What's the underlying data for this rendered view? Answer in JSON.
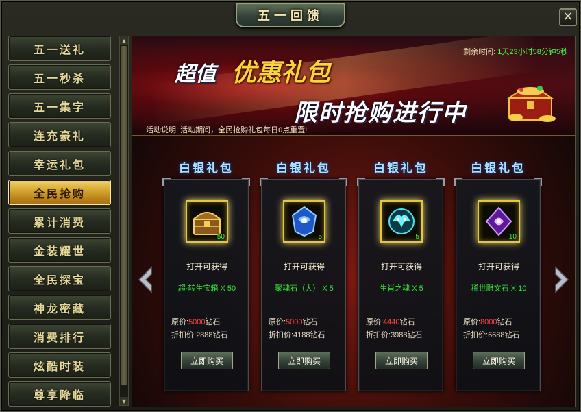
{
  "window": {
    "title": "五一回馈",
    "close_label": "✕"
  },
  "sidebar": {
    "items": [
      {
        "label": "五一送礼",
        "active": false
      },
      {
        "label": "五一秒杀",
        "active": false
      },
      {
        "label": "五一集字",
        "active": false
      },
      {
        "label": "连充豪礼",
        "active": false
      },
      {
        "label": "幸运礼包",
        "active": false
      },
      {
        "label": "全民抢购",
        "active": true
      },
      {
        "label": "累计消费",
        "active": false
      },
      {
        "label": "金装耀世",
        "active": false
      },
      {
        "label": "全民探宝",
        "active": false
      },
      {
        "label": "神龙密藏",
        "active": false
      },
      {
        "label": "消费排行",
        "active": false
      },
      {
        "label": "炫酷时装",
        "active": false
      },
      {
        "label": "尊享降临",
        "active": false
      }
    ]
  },
  "banner": {
    "line1_a": "超值",
    "line1_b": "优惠礼包",
    "line2": "限时抢购进行中",
    "timer_label": "剩余时间:",
    "timer_value": "1天23小时58分钟5秒",
    "desc": "活动说明: 活动期间，全民抢购礼包每日0点重置!"
  },
  "cards": [
    {
      "title": "白银礼包",
      "icon": "treasure-chest-icon",
      "count": "50",
      "open_label": "打开可获得",
      "item_name": "超·转生宝箱 X 50",
      "orig_label": "原价:",
      "orig_value": "5000",
      "orig_unit": "钻石",
      "disc_label": "折扣价:",
      "disc_value": "2888钻石",
      "buy_label": "立即购买"
    },
    {
      "title": "白银礼包",
      "icon": "blue-soul-stone-icon",
      "count": "5",
      "open_label": "打开可获得",
      "item_name": "聚魂石（大） X 5",
      "orig_label": "原价:",
      "orig_value": "5000",
      "orig_unit": "钻石",
      "disc_label": "折扣价:",
      "disc_value": "4188钻石",
      "buy_label": "立即购买"
    },
    {
      "title": "白银礼包",
      "icon": "zodiac-soul-icon",
      "count": "5",
      "open_label": "打开可获得",
      "item_name": "生肖之魂 X 5",
      "orig_label": "原价:",
      "orig_value": "4440",
      "orig_unit": "钻石",
      "disc_label": "折扣价:",
      "disc_value": "3988钻石",
      "buy_label": "立即购买"
    },
    {
      "title": "白银礼包",
      "icon": "purple-rune-stone-icon",
      "count": "10",
      "open_label": "打开可获得",
      "item_name": "稀世雕文石 X 10",
      "orig_label": "原价:",
      "orig_value": "8000",
      "orig_unit": "钻石",
      "disc_label": "折扣价:",
      "disc_value": "6688钻石",
      "buy_label": "立即购买"
    }
  ],
  "colors": {
    "accent_gold": "#e6c640",
    "timer_green": "#44ff44",
    "item_green": "#36e436",
    "price_red": "#ff4040"
  }
}
